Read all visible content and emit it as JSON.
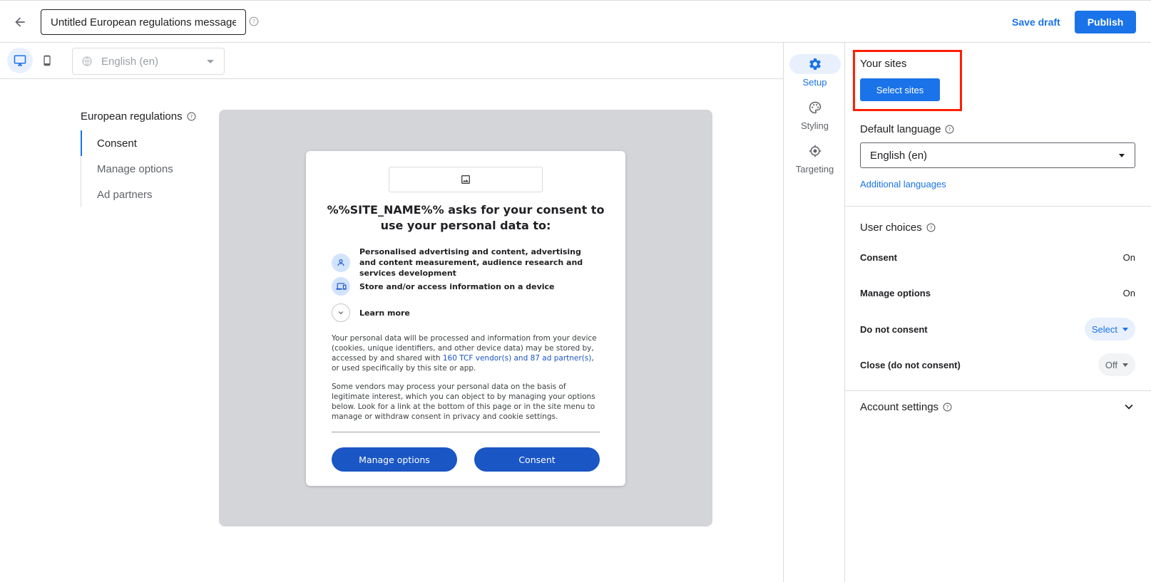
{
  "header": {
    "title_value": "Untitled European regulations message",
    "save_draft_label": "Save draft",
    "publish_label": "Publish"
  },
  "toolbar": {
    "language_value": "English (en)"
  },
  "left_nav": {
    "title": "European regulations",
    "items": [
      {
        "label": "Consent",
        "active": true
      },
      {
        "label": "Manage options",
        "active": false
      },
      {
        "label": "Ad partners",
        "active": false
      }
    ]
  },
  "preview": {
    "heading": "%%SITE_NAME%% asks for your consent to use your personal data to:",
    "purposes": [
      "Personalised advertising and content, advertising and content measurement, audience research and services development",
      "Store and/or access information on a device",
      "Learn more"
    ],
    "para1_before": "Your personal data will be processed and information from your device (cookies, unique identifiers, and other device data) may be stored by, accessed by and shared with ",
    "para1_link": "160 TCF vendor(s) and 87 ad partner(s)",
    "para1_after": ", or used specifically by this site or app.",
    "para2": "Some vendors may process your personal data on the basis of legitimate interest, which you can object to by managing your options below. Look for a link at the bottom of this page or in the site menu to manage or withdraw consent in privacy and cookie settings.",
    "manage_options_label": "Manage options",
    "consent_label": "Consent"
  },
  "rail": {
    "items": [
      {
        "label": "Setup",
        "icon": "gear-icon",
        "active": true
      },
      {
        "label": "Styling",
        "icon": "palette-icon",
        "active": false
      },
      {
        "label": "Targeting",
        "icon": "target-icon",
        "active": false
      }
    ]
  },
  "settings": {
    "your_sites_title": "Your sites",
    "select_sites_label": "Select sites",
    "default_language_title": "Default language",
    "default_language_value": "English (en)",
    "additional_languages_label": "Additional languages",
    "user_choices_title": "User choices",
    "choices": [
      {
        "label": "Consent",
        "value": "On"
      },
      {
        "label": "Manage options",
        "value": "On"
      },
      {
        "label": "Do not consent",
        "value": "Select"
      },
      {
        "label": "Close (do not consent)",
        "value": "Off"
      }
    ],
    "account_settings_title": "Account settings"
  },
  "colors": {
    "accent": "#1a73e8",
    "highlight": "#ff1e00",
    "preview_bg": "#d4d5d9"
  }
}
